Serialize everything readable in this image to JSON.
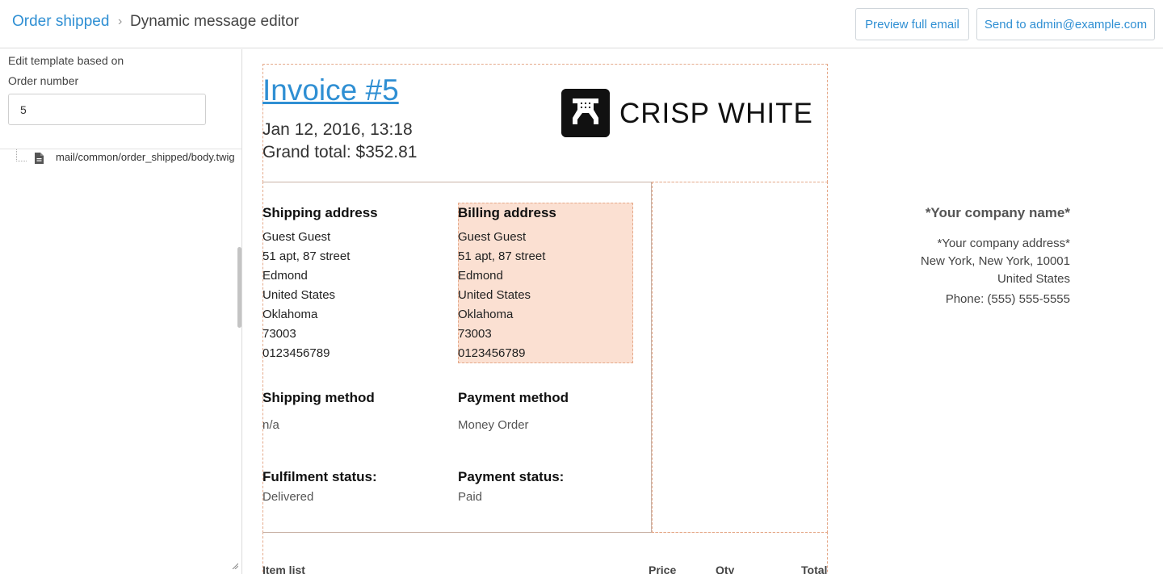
{
  "header": {
    "breadcrumb_link": "Order shipped",
    "breadcrumb_separator": "›",
    "breadcrumb_current": "Dynamic message editor",
    "preview_button": "Preview full email",
    "send_button": "Send to admin@example.com"
  },
  "sidebar": {
    "template_label": "Edit template based on",
    "order_number_label": "Order number",
    "order_number_value": "5",
    "file_path": "mail/common/order_shipped/body.twig"
  },
  "invoice": {
    "title": "Invoice #5",
    "date": "Jan 12, 2016, 13:18",
    "grand_total": "Grand total: $352.81",
    "logo_text": "CRISP WHITE",
    "shipping_address_heading": "Shipping address",
    "shipping_address_lines": [
      "Guest Guest",
      "51 apt, 87 street",
      "Edmond",
      "United States",
      "Oklahoma",
      "73003",
      "0123456789"
    ],
    "billing_address_heading": "Billing address",
    "billing_address_lines": [
      "Guest Guest",
      "51 apt, 87 street",
      "Edmond",
      "United States",
      "Oklahoma",
      "73003",
      "0123456789"
    ],
    "shipping_method_heading": "Shipping method",
    "shipping_method_value": "n/a",
    "payment_method_heading": "Payment method",
    "payment_method_value": "Money Order",
    "fulfilment_status_heading": "Fulfilment status:",
    "fulfilment_status_value": "Delivered",
    "payment_status_heading": "Payment status:",
    "payment_status_value": "Paid",
    "company": {
      "name": "*Your company name*",
      "address": "*Your company address*",
      "city": "New York, New York, 10001",
      "country": "United States",
      "phone": "Phone: (555) 555-5555"
    },
    "items_table": {
      "col_item": "Item list",
      "col_price": "Price",
      "col_qty": "Qty",
      "col_total": "Total"
    }
  },
  "colors": {
    "accent": "#2f8fd3",
    "highlight": "#fbe0d2",
    "dashed_border": "#e5a98a"
  },
  "icons": {
    "file": "file-icon",
    "logo": "crisp-white-logo-icon"
  }
}
